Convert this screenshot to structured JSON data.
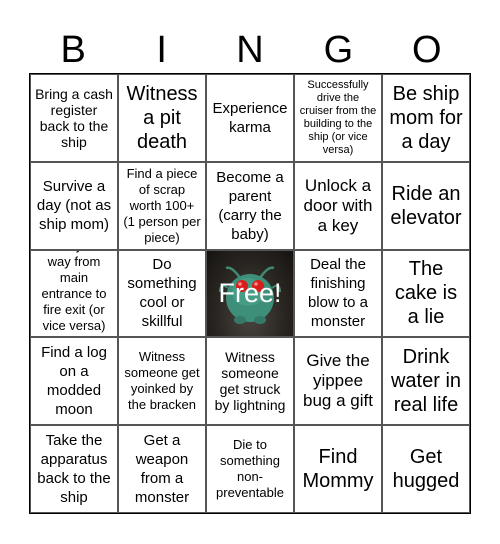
{
  "header": {
    "letters": [
      "B",
      "I",
      "N",
      "G",
      "O"
    ]
  },
  "free_space": {
    "label": "Free!",
    "image": "yippee-bug-image"
  },
  "cells": [
    [
      "Bring a cash register back to the ship",
      "Witness a pit death",
      "Experience karma",
      "Successfully drive the cruiser from the building to the ship (or vice versa)",
      "Be ship mom for a day"
    ],
    [
      "Survive a day (not as ship mom)",
      "Find a piece of scrap worth 100+ (1 person per piece)",
      "Become a parent (carry the baby)",
      "Unlock a door with a key",
      "Ride an elevator"
    ],
    [
      "Find your way from main entrance to fire exit (or vice versa) inside",
      "Do something cool or skillful",
      "Free!",
      "Deal the finishing blow to a monster",
      "The cake is a lie"
    ],
    [
      "Find a log on a modded moon",
      "Witness someone get yoinked by the bracken",
      "Witness someone get struck by lightning",
      "Give the yippee bug a gift",
      "Drink water in real life"
    ],
    [
      "Take the apparatus back to the ship",
      "Get a weapon from a monster",
      "Die to something non-preventable",
      "Find Mommy",
      "Get hugged"
    ]
  ]
}
